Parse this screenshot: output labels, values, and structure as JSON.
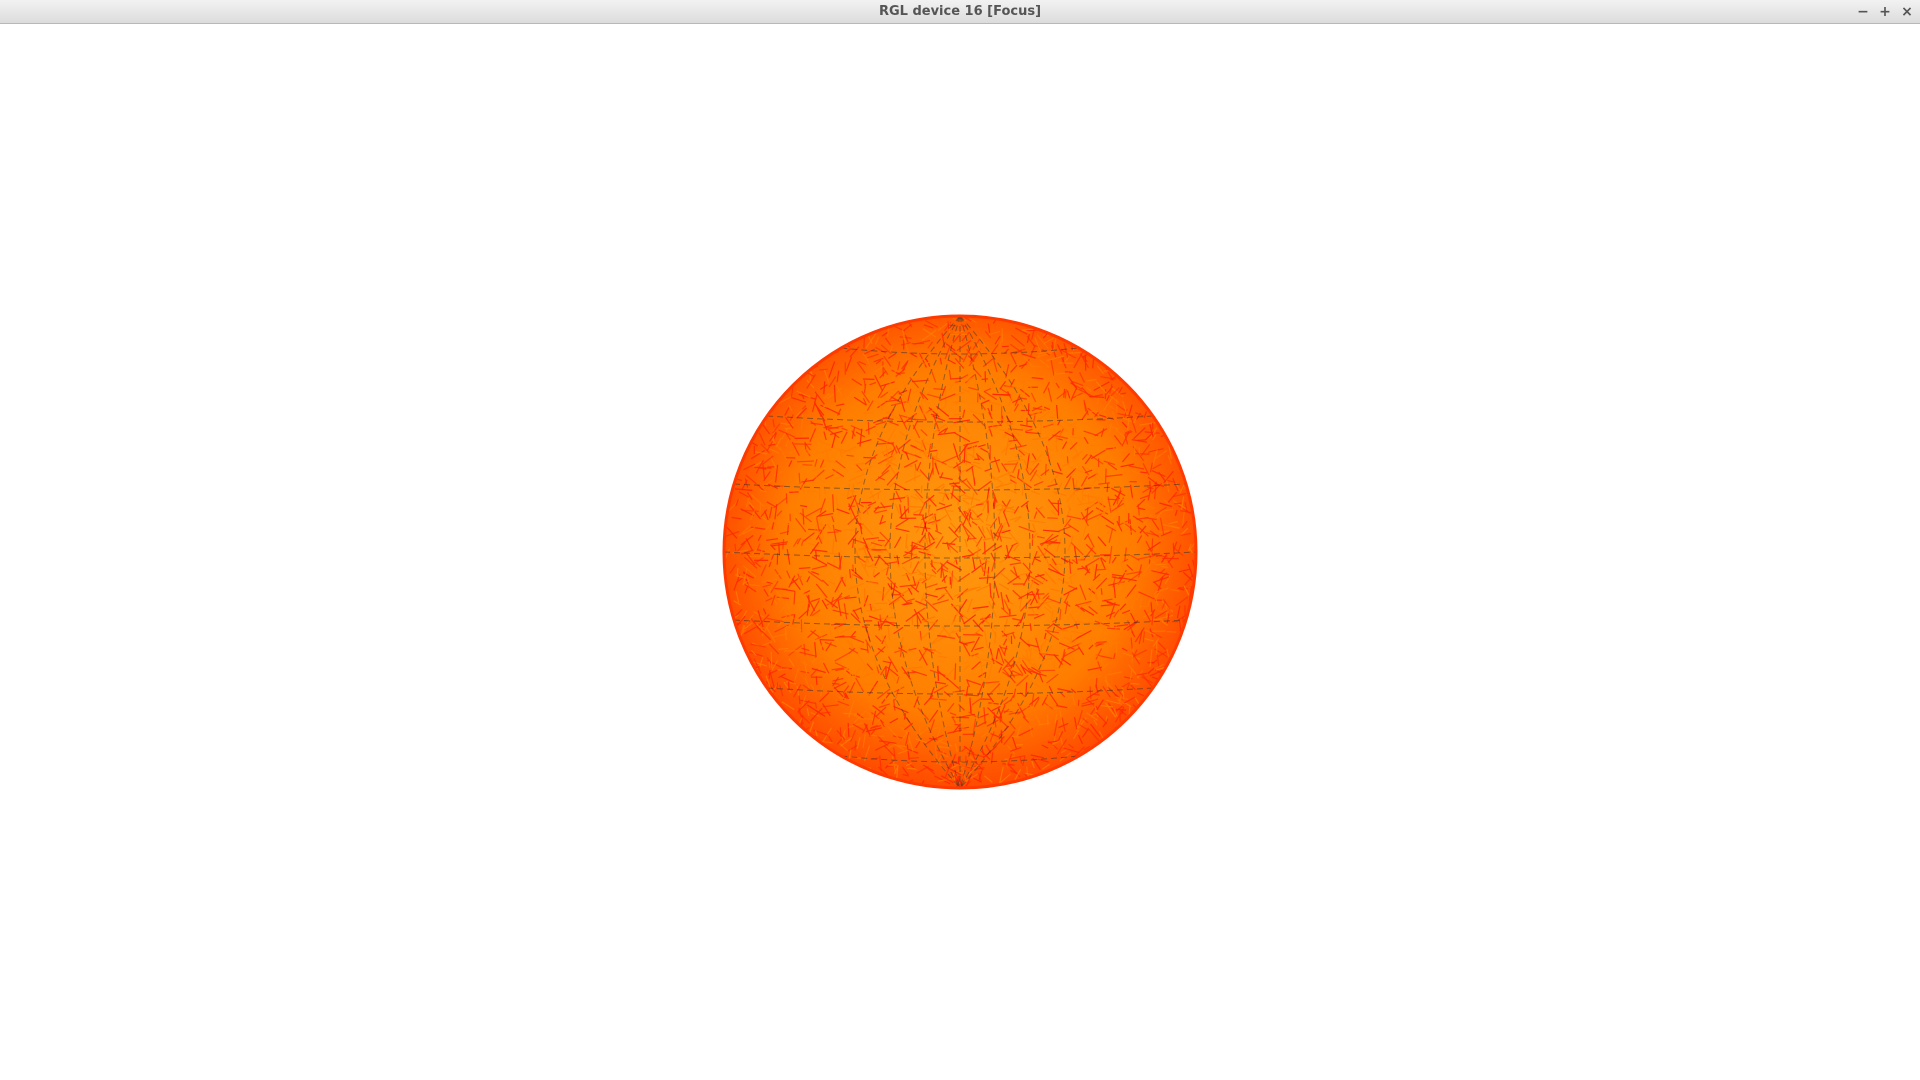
{
  "window": {
    "title": "RGL device 16 [Focus]",
    "controls": {
      "minimize_icon": "minimize-icon",
      "maximize_icon": "maximize-icon",
      "close_icon": "close-icon",
      "minimize_glyph": "−",
      "maximize_glyph": "+",
      "close_glyph": "×"
    }
  },
  "scene": {
    "object": "sphere",
    "colors": {
      "background": "#ffffff",
      "sphere_base": "#ff8c00",
      "sphere_edge": "#ff4500",
      "hairs_primary": "#ff2a00",
      "hairs_secondary": "#ff7a00",
      "grid_lines": "#333333"
    }
  }
}
